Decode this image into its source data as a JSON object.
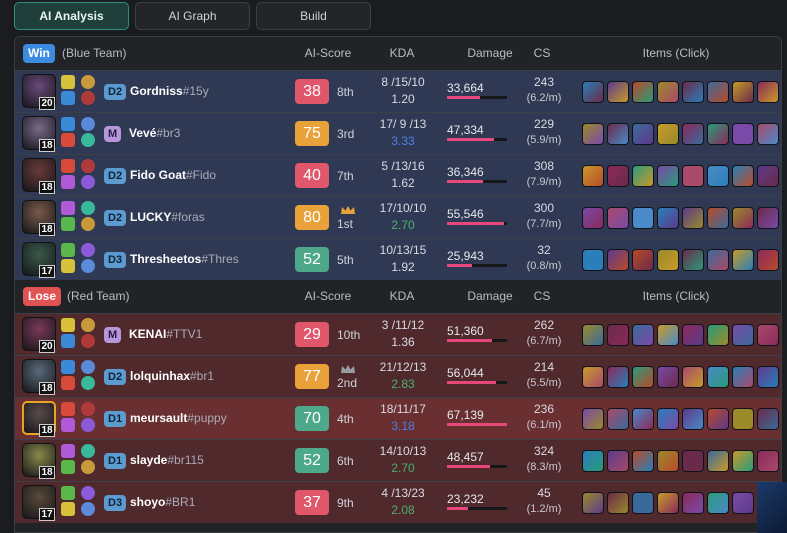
{
  "tabs": [
    "AI Analysis",
    "AI Graph",
    "Build"
  ],
  "headers": {
    "ai_score": "AI-Score",
    "kda": "KDA",
    "damage": "Damage",
    "cs": "CS",
    "items": "Items (Click)"
  },
  "teams": [
    {
      "result": "Win",
      "name": "(Blue Team)",
      "badge_color": "#3d8be0",
      "players": [
        {
          "level": "20",
          "rank": "D2",
          "name": "Gordniss",
          "tag": "#15y",
          "score": "38",
          "place": "8th",
          "kda": "8 /15/10",
          "kda_ratio": "1.20",
          "damage": "33,664",
          "damage_pct": 0.55,
          "cs": "243",
          "cs_min": "(6.2/m)"
        },
        {
          "level": "18",
          "rank": "M",
          "name": "Vevé",
          "tag": "#br3",
          "score": "75",
          "place": "3rd",
          "kda": "17/ 9 /13",
          "kda_ratio": "3.33",
          "damage": "47,334",
          "damage_pct": 0.78,
          "cs": "229",
          "cs_min": "(5.9/m)"
        },
        {
          "level": "18",
          "rank": "D2",
          "name": "Fido Goat",
          "tag": "#Fido",
          "score": "40",
          "place": "7th",
          "kda": "5 /13/16",
          "kda_ratio": "1.62",
          "damage": "36,346",
          "damage_pct": 0.6,
          "cs": "308",
          "cs_min": "(7.9/m)"
        },
        {
          "level": "18",
          "rank": "D2",
          "name": "LUCKY",
          "tag": "#foras",
          "score": "80",
          "place": "1st",
          "crowned": true,
          "kda": "17/10/10",
          "kda_ratio": "2.70",
          "damage": "55,546",
          "damage_pct": 0.95,
          "cs": "300",
          "cs_min": "(7.7/m)"
        },
        {
          "level": "17",
          "rank": "D3",
          "name": "Thresheetos",
          "tag": "#Thres",
          "score": "52",
          "place": "5th",
          "kda": "10/13/15",
          "kda_ratio": "1.92",
          "damage": "25,943",
          "damage_pct": 0.42,
          "cs": "32",
          "cs_min": "(0.8/m)"
        }
      ]
    },
    {
      "result": "Lose",
      "name": "(Red Team)",
      "badge_color": "#e05353",
      "players": [
        {
          "level": "20",
          "rank": "M",
          "name": "KENAI",
          "tag": "#TTV1",
          "score": "29",
          "place": "10th",
          "kda": "3 /11/12",
          "kda_ratio": "1.36",
          "damage": "51,360",
          "damage_pct": 0.75,
          "cs": "262",
          "cs_min": "(6.7/m)"
        },
        {
          "level": "18",
          "rank": "D2",
          "name": "lolquinhax",
          "tag": "#br1",
          "score": "77",
          "place": "2nd",
          "crowned": true,
          "kda": "21/12/13",
          "kda_ratio": "2.83",
          "damage": "56,044",
          "damage_pct": 0.82,
          "cs": "214",
          "cs_min": "(5.5/m)"
        },
        {
          "level": "18",
          "rank": "D1",
          "name": "meursault",
          "tag": "#puppy",
          "score": "70",
          "place": "4th",
          "selected": true,
          "kda": "18/11/17",
          "kda_ratio": "3.18",
          "damage": "67,139",
          "damage_pct": 1.0,
          "cs": "236",
          "cs_min": "(6.1/m)"
        },
        {
          "level": "18",
          "rank": "D1",
          "name": "slayde",
          "tag": "#br115",
          "score": "52",
          "place": "6th",
          "kda": "14/10/13",
          "kda_ratio": "2.70",
          "damage": "48,457",
          "damage_pct": 0.72,
          "cs": "324",
          "cs_min": "(8.3/m)"
        },
        {
          "level": "17",
          "rank": "D3",
          "name": "shoyo",
          "tag": "#BR1",
          "score": "37",
          "place": "9th",
          "kda": "4 /13/23",
          "kda_ratio": "2.08",
          "damage": "23,232",
          "damage_pct": 0.35,
          "cs": "45",
          "cs_min": "(1.2/m)"
        }
      ]
    }
  ],
  "colors": {
    "score_high": "#4ea88a",
    "score_mid": "#e9a23a",
    "score_low": "#e0566a",
    "kda_blue": "#4f7ee8",
    "kda_green": "#4caf6e",
    "kda_default": "#d8dbe2",
    "damage_bar": "#e5487a"
  }
}
